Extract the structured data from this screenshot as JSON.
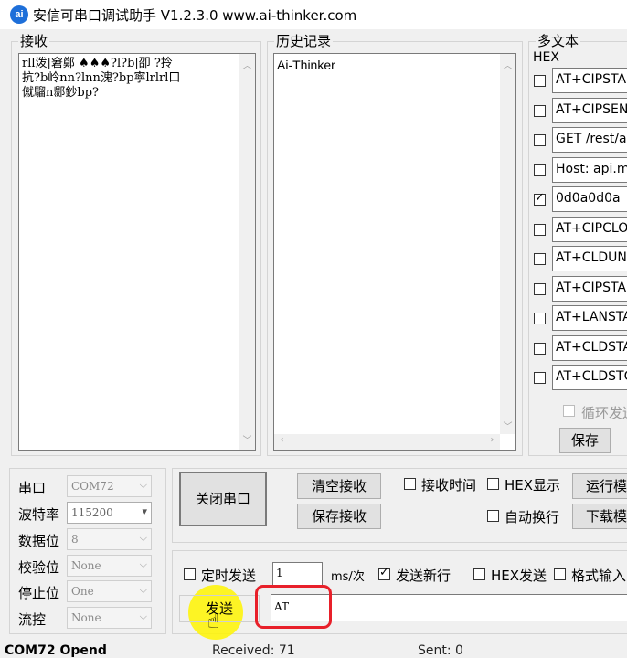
{
  "window": {
    "title": "安信可串口调试助手 V1.2.3.0    www.ai-thinker.com",
    "app_icon": "ai"
  },
  "receive": {
    "group_label": "接收",
    "text_lines": [
      "rll泼|窘鄭 ♠♠♠?l?b|卲 ?拎",
      "抗?b岭nn?lnn溾?bp寧lrlrl口",
      "僦騮n郻鈔bp?"
    ]
  },
  "history": {
    "group_label": "历史记录",
    "items": [
      "Ai-Thinker"
    ]
  },
  "multitext": {
    "group_label": "多文本",
    "hex_label": "HEX",
    "rows": [
      {
        "checked": false,
        "value": "AT+CIPSTA"
      },
      {
        "checked": false,
        "value": "AT+CIPSEN"
      },
      {
        "checked": false,
        "value": "GET /rest/ap"
      },
      {
        "checked": false,
        "value": "Host: api.m"
      },
      {
        "checked": true,
        "value": "0d0a0d0a"
      },
      {
        "checked": false,
        "value": "AT+CIPCLO"
      },
      {
        "checked": false,
        "value": "AT+CLDUN"
      },
      {
        "checked": false,
        "value": "AT+CIPSTA"
      },
      {
        "checked": false,
        "value": "AT+LANSTA"
      },
      {
        "checked": false,
        "value": "AT+CLDSTA"
      },
      {
        "checked": false,
        "value": "AT+CLDSTO"
      }
    ],
    "loop_send_label": "循环发送",
    "save_button": "保存"
  },
  "settings": {
    "port": {
      "label": "串口",
      "value": "COM72"
    },
    "baud": {
      "label": "波特率",
      "value": "115200"
    },
    "databits": {
      "label": "数据位",
      "value": "8"
    },
    "parity": {
      "label": "校验位",
      "value": "None"
    },
    "stopbits": {
      "label": "停止位",
      "value": "One"
    },
    "flow": {
      "label": "流控",
      "value": "None"
    }
  },
  "controls": {
    "close_port": "关闭串口",
    "clear_receive": "清空接收",
    "save_receive": "保存接收",
    "receive_time": {
      "label": "接收时间",
      "checked": false
    },
    "hex_display": {
      "label": "HEX显示",
      "checked": false
    },
    "auto_wrap": {
      "label": "自动换行",
      "checked": false
    },
    "run_mode": "运行模",
    "download_mode": "下载模"
  },
  "send": {
    "timed_send": {
      "label": "定时发送",
      "checked": false
    },
    "interval": "1",
    "interval_unit": "ms/次",
    "send_newline": {
      "label": "发送新行",
      "checked": true
    },
    "hex_send": {
      "label": "HEX发送",
      "checked": false
    },
    "format_input": {
      "label": "格式输入",
      "checked": false
    },
    "send_button": "发送",
    "input_value": "AT"
  },
  "status": {
    "port_state": "COM72 Opend",
    "received": "Received: 71",
    "sent": "Sent: 0"
  },
  "colors": {
    "highlight": "#e8202a",
    "cursor_glow": "#fff500"
  }
}
